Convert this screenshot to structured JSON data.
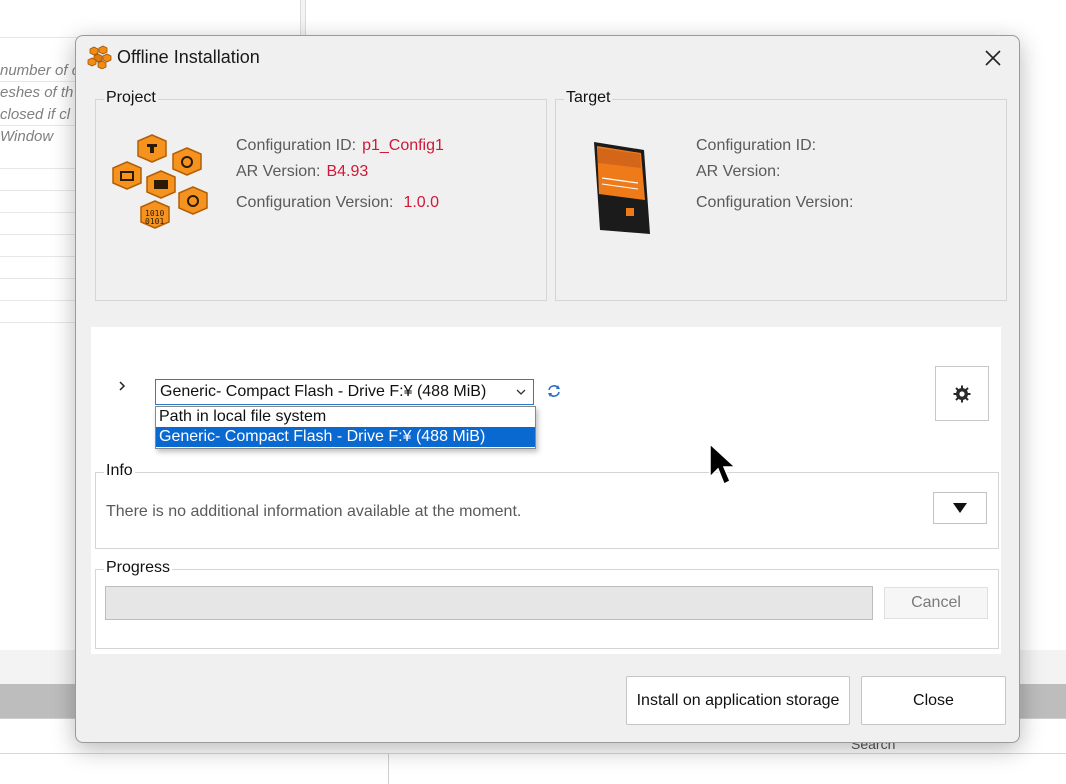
{
  "background": {
    "text_lines": [
      "number of c",
      "eshes of th",
      "closed if cl",
      "Window"
    ],
    "search_label": "Search"
  },
  "dialog": {
    "title": "Offline Installation",
    "icons": {
      "app": "bundle-icon",
      "close": "close-icon",
      "settings": "gear-icon",
      "expand": "triangle-down-icon",
      "refresh": "refresh-icon",
      "chevron": "chevron-right-icon",
      "dropdown_arrow": "chevron-down-icon"
    },
    "project": {
      "label": "Project",
      "config_id_label": "Configuration ID:",
      "config_id_value": "p1_Config1",
      "ar_version_label": "AR Version:",
      "ar_version_value": "B4.93",
      "config_version_label": "Configuration Version:",
      "config_version_value": "1.0.0"
    },
    "target": {
      "label": "Target",
      "config_id_label": "Configuration ID:",
      "config_id_value": "",
      "ar_version_label": "AR Version:",
      "ar_version_value": "",
      "config_version_label": "Configuration Version:",
      "config_version_value": ""
    },
    "device_select": {
      "selected": "Generic- Compact Flash - Drive F:¥ (488 MiB)",
      "options": [
        "Path in local file system",
        "Generic- Compact Flash - Drive F:¥ (488 MiB)"
      ],
      "selected_index": 1
    },
    "info": {
      "label": "Info",
      "message": "There is no additional information available at the moment."
    },
    "progress": {
      "label": "Progress",
      "percent": 0,
      "cancel_label": "Cancel"
    },
    "buttons": {
      "install": "Install on application storage",
      "close": "Close"
    },
    "colors": {
      "value_red": "#d1183a",
      "selection_blue": "#0a68d1",
      "accent_orange": "#f28c12"
    }
  }
}
